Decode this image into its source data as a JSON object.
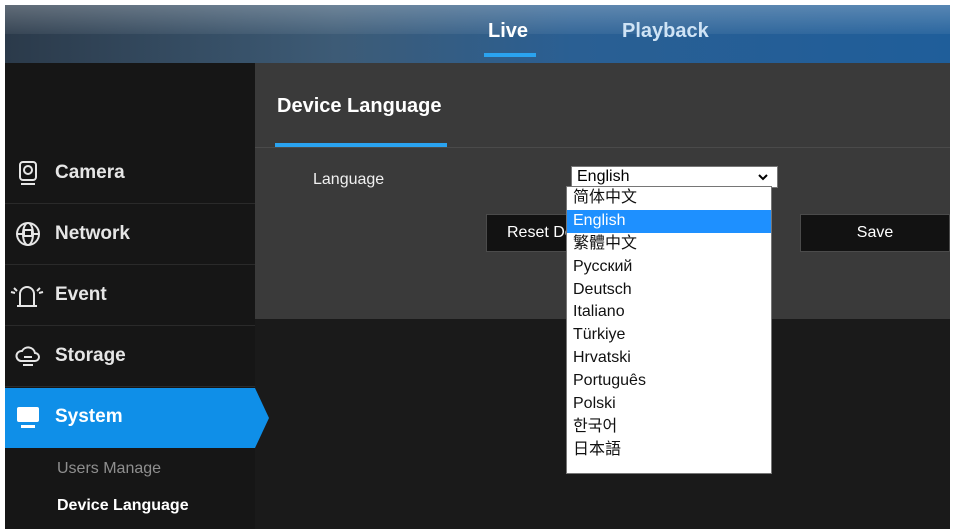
{
  "topnav": {
    "live": "Live",
    "playback": "Playback"
  },
  "sidebar": {
    "items": [
      {
        "label": "Camera",
        "icon": "camera-icon"
      },
      {
        "label": "Network",
        "icon": "network-globe-icon"
      },
      {
        "label": "Event",
        "icon": "alarm-event-icon"
      },
      {
        "label": "Storage",
        "icon": "cloud-storage-icon"
      },
      {
        "label": "System",
        "icon": "monitor-system-icon",
        "active": true
      }
    ],
    "subitems": [
      {
        "label": "Users Manage"
      },
      {
        "label": "Device Language",
        "current": true
      }
    ]
  },
  "main": {
    "title": "Device Language",
    "language_label": "Language",
    "select_value": "English",
    "reset_label": "Reset Default",
    "save_label": "Save"
  },
  "dropdown": {
    "options": [
      "简体中文",
      "English",
      "繁體中文",
      "Русский",
      "Deutsch",
      "Italiano",
      "Türkiye",
      "Hrvatski",
      "Português",
      "Polski",
      "한국어",
      "日本語"
    ],
    "selected": "English"
  },
  "colors": {
    "accent": "#0f8fe8",
    "highlight": "#1e90ff",
    "content_bg": "#3a3a3a",
    "sidebar_bg": "#161616"
  }
}
